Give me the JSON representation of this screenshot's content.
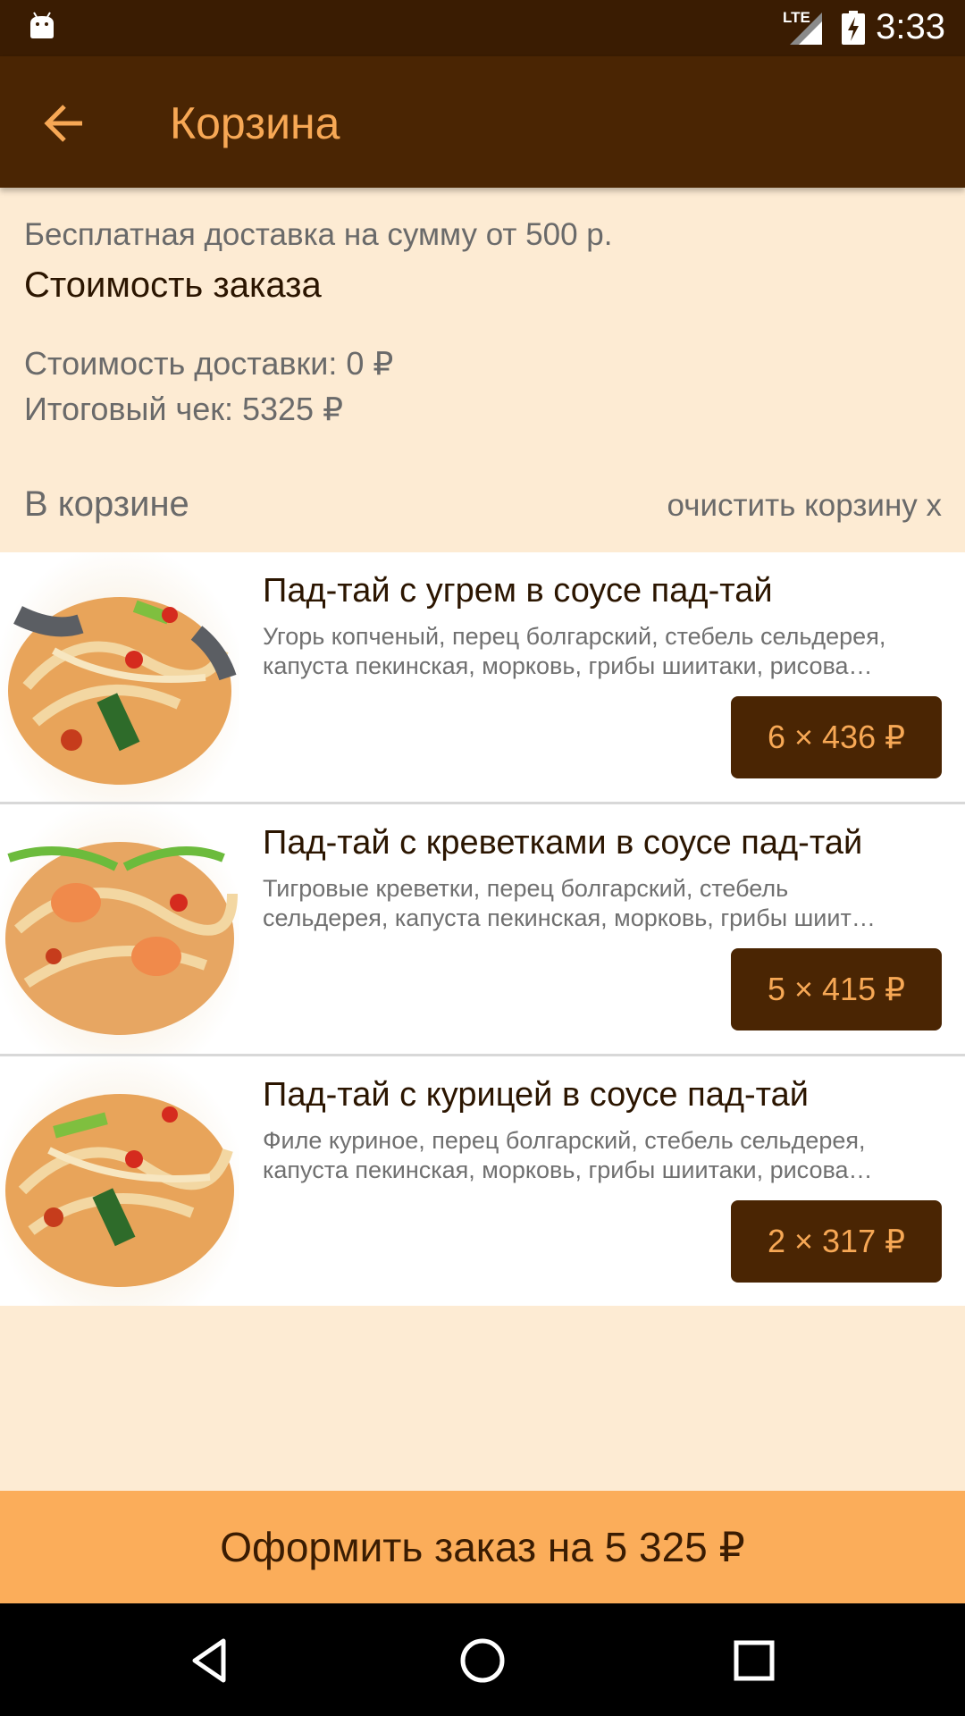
{
  "status_bar": {
    "network": "LTE",
    "time": "3:33"
  },
  "app_bar": {
    "title": "Корзина"
  },
  "summary": {
    "free_delivery_note": "Бесплатная доставка на сумму от 500 р.",
    "order_cost_heading": "Стоимость заказа",
    "delivery_cost": "Стоимость доставки: 0 ₽",
    "total": "Итоговый чек: 5325 ₽"
  },
  "cart": {
    "heading": "В корзине",
    "clear_label": "очистить корзину х",
    "items": [
      {
        "name": "Пад-тай с угрем в соусе пад-тай",
        "desc_line1": "Угорь копченый, перец болгарский, стебель сельдерея,",
        "desc_line2": "капуста пекинская, морковь, грибы шиитаки, рисова…",
        "quantity_price": "6 × 436 ₽"
      },
      {
        "name": "Пад-тай с креветками в соусе пад-тай",
        "desc_line1": "Тигровые креветки, перец болгарский, стебель",
        "desc_line2": "сельдерея, капуста пекинская, морковь, грибы шиит…",
        "quantity_price": "5 × 415 ₽"
      },
      {
        "name": "Пад-тай с курицей в соусе пад-тай",
        "desc_line1": "Филе куриное, перец болгарский, стебель сельдерея,",
        "desc_line2": "капуста пекинская, морковь, грибы шиитаки, рисова…",
        "quantity_price": "2 × 317 ₽"
      }
    ]
  },
  "checkout": {
    "label": "Оформить заказ на 5 325 ₽"
  },
  "colors": {
    "status_bar": "#3a1c02",
    "app_bar": "#4a2503",
    "accent_orange": "#f7a855",
    "checkout_bar": "#fbad5a",
    "background": "#fdebd3"
  },
  "icons": [
    "android-icon",
    "signal-icon",
    "battery-charging-icon",
    "back-arrow-icon",
    "nav-back-icon",
    "nav-home-icon",
    "nav-recents-icon"
  ]
}
